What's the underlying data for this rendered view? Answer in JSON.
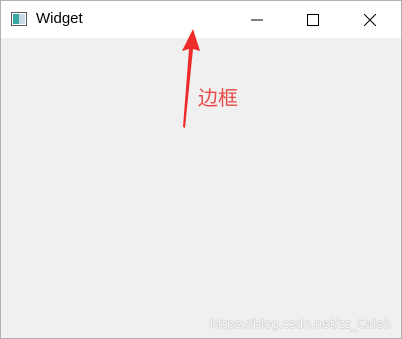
{
  "window": {
    "title": "Widget",
    "app_icon": "qt-window-icon"
  },
  "controls": {
    "minimize_icon": "minimize-icon",
    "maximize_icon": "maximize-icon",
    "close_icon": "close-icon"
  },
  "annotation": {
    "label": "边框",
    "color": "#e94a4a",
    "arrow_icon": "arrow-up-icon"
  },
  "watermark": {
    "text": "https://blog.csdn.net/zz_Caleb"
  },
  "colors": {
    "titlebar_bg": "#ffffff",
    "client_bg": "#f0f0f0",
    "frame_border": "#b0b0b0"
  }
}
